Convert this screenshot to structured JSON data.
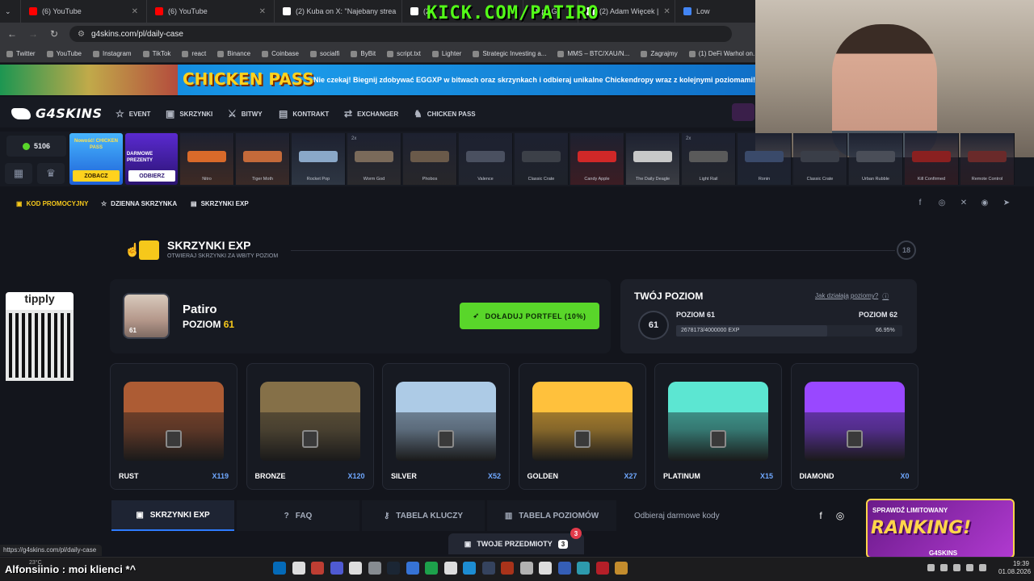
{
  "browser": {
    "tabs": [
      {
        "title": "(6) YouTube",
        "color": "#ff0000"
      },
      {
        "title": "(6) YouTube",
        "color": "#ff0000"
      },
      {
        "title": "(2) Kuba on X: \"Najebany strea",
        "color": "#ffffff"
      },
      {
        "title": "(2",
        "color": "#ffffff"
      },
      {
        "title": "Mapy G",
        "color": "#34a853"
      },
      {
        "title": "(2) Adam Więcek |",
        "color": "#ffffff"
      },
      {
        "title": "Low",
        "color": "#4285f4"
      }
    ],
    "url": "g4skins.com/pl/daily-case",
    "bookmarks": [
      "Twitter",
      "YouTube",
      "Instagram",
      "TikTok",
      "react",
      "Binance",
      "Coinbase",
      "socialfi",
      "ByBit",
      "script.txt",
      "Lighter",
      "Strategic Investing a...",
      "MMS – BTC/XAU/N...",
      "Zagrajmy",
      "(1) DeFi Warhol on..."
    ],
    "status_url": "https://g4skins.com/pl/daily-case"
  },
  "overlay": {
    "kick": "KICK.COM/PATIRO",
    "tipply": "tipply",
    "chat": "Alfonsiinio : moi klienci *^",
    "weather": "23°C"
  },
  "banner": {
    "title": "CHICKEN PASS",
    "text": "Nie czekaj! Biegnij zdobywać EGGXP w bitwach oraz skrzynkach i odbieraj unikalne Chickendropy wraz z kolejnymi poziomami!"
  },
  "site": {
    "logo": "G4SKINS",
    "nav": [
      "EVENT",
      "SKRZYNKI",
      "BITWY",
      "KONTRAKT",
      "EXCHANGER",
      "CHICKEN PASS"
    ],
    "balance": "5106",
    "promo1": {
      "text": "Nowość! CHICKEN PASS",
      "button": "ZOBACZ"
    },
    "promo2": {
      "text": "DARMOWE PREZENTY",
      "button": "ODBIERZ"
    },
    "cases": [
      {
        "name": "Nitro",
        "color": "#d96a2a"
      },
      {
        "name": "Tiger Moth",
        "color": "#c46a3a"
      },
      {
        "name": "Rocket Pop",
        "color": "#8aa8c8"
      },
      {
        "name": "Worm God",
        "color": "#7a6a5a"
      },
      {
        "name": "Phobos",
        "color": "#6a5a4a"
      },
      {
        "name": "Valence",
        "color": "#4a5060"
      },
      {
        "name": "Classic Crate",
        "color": "#3c4048"
      },
      {
        "name": "Candy Apple",
        "color": "#d02828"
      },
      {
        "name": "The Daily Deagle",
        "color": "#c8c8c8"
      },
      {
        "name": "Light Rail",
        "color": "#5a5a5a"
      },
      {
        "name": "Ronin",
        "color": "#3a4a6a"
      },
      {
        "name": "Classic Crate",
        "color": "#3a3e48"
      },
      {
        "name": "Urban Rubble",
        "color": "#4a4e58"
      },
      {
        "name": "Kill Confirmed",
        "color": "#8a2020"
      },
      {
        "name": "Remote Control",
        "color": "#6a2a2a"
      }
    ],
    "case_marks": [
      "2x",
      "2x"
    ],
    "subnav": [
      "KOD PROMOCYJNY",
      "DZIENNA SKRZYNKA",
      "SKRZYNKI EXP"
    ],
    "section": {
      "title": "SKRZYNKI EXP",
      "subtitle": "OTWIERAJ SKRZYNKI ZA WBITY POZIOM",
      "age": "18"
    },
    "profile": {
      "name": "Patiro",
      "level_label": "POZIOM",
      "level": "61",
      "topup": "DOŁADUJ PORTFEL (10%)"
    },
    "levelbox": {
      "title": "TWÓJ POZIOM",
      "how": "Jak działają poziomy?",
      "badge": "61",
      "current": "POZIOM 61",
      "next": "POZIOM 62",
      "exp": "2678173/4000000 EXP",
      "percent": "66.95%",
      "progress": 0.6695
    },
    "chests": [
      {
        "name": "RUST",
        "count": "X119",
        "color": "#8a4a2a"
      },
      {
        "name": "BRONZE",
        "count": "X120",
        "color": "#6a5a3a"
      },
      {
        "name": "SILVER",
        "count": "X52",
        "color": "#8aa2b8"
      },
      {
        "name": "GOLDEN",
        "count": "X27",
        "color": "#d09a30"
      },
      {
        "name": "PLATINUM",
        "count": "X15",
        "color": "#4ab8a8"
      },
      {
        "name": "DIAMOND",
        "count": "X0",
        "color": "#7a3ad0"
      }
    ],
    "bottom_tabs": [
      "SKRZYNKI EXP",
      "FAQ",
      "TABELA KLUCZY",
      "TABELA POZIOMÓW"
    ],
    "free_codes": "Odbieraj darmowe kody",
    "inventory": {
      "label": "TWOJE PRZEDMIOTY",
      "count": "3",
      "badge": "3"
    },
    "ranking": {
      "line1": "SPRAWDŹ LIMITOWANY",
      "line2": "RANKING!",
      "line3": "G4SKINS"
    }
  },
  "taskbar": {
    "time": "19:39",
    "date": "01.08.2026"
  }
}
